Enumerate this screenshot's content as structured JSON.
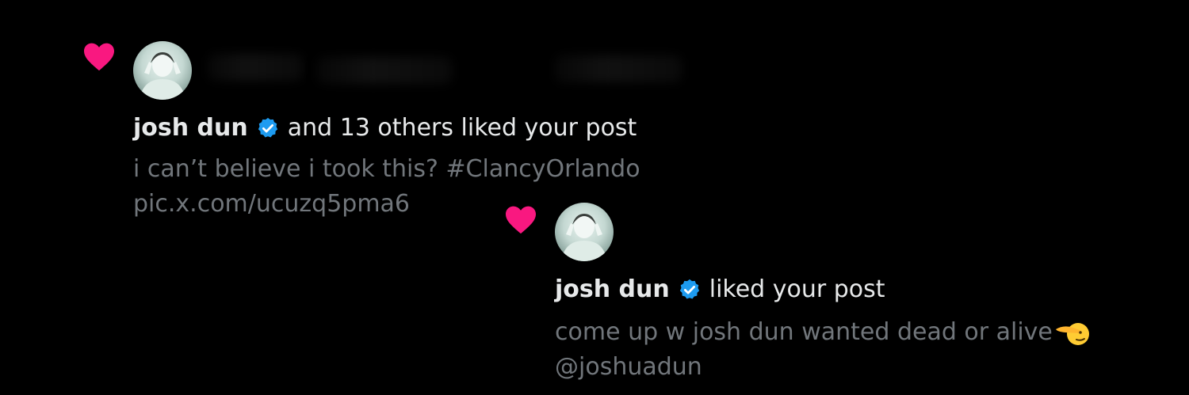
{
  "notifications": [
    {
      "name": "josh dun",
      "action": "and 13 others liked your post",
      "post_line1": "i can’t believe i took this? #ClancyOrlando",
      "post_line2": "pic.x.com/ucuzq5pma6"
    },
    {
      "name": "josh dun",
      "action": "liked your post",
      "post_line1": "come up w josh dun wanted dead or alive",
      "post_line2": "@joshuadun"
    }
  ],
  "colors": {
    "background": "#000000",
    "heart": "#f91880",
    "verified": "#1d9bf0",
    "primary_text": "#e7e9ea",
    "secondary_text": "#71767b"
  },
  "icons": [
    "heart-icon",
    "verified-badge-icon",
    "saluting-face-emoji"
  ]
}
